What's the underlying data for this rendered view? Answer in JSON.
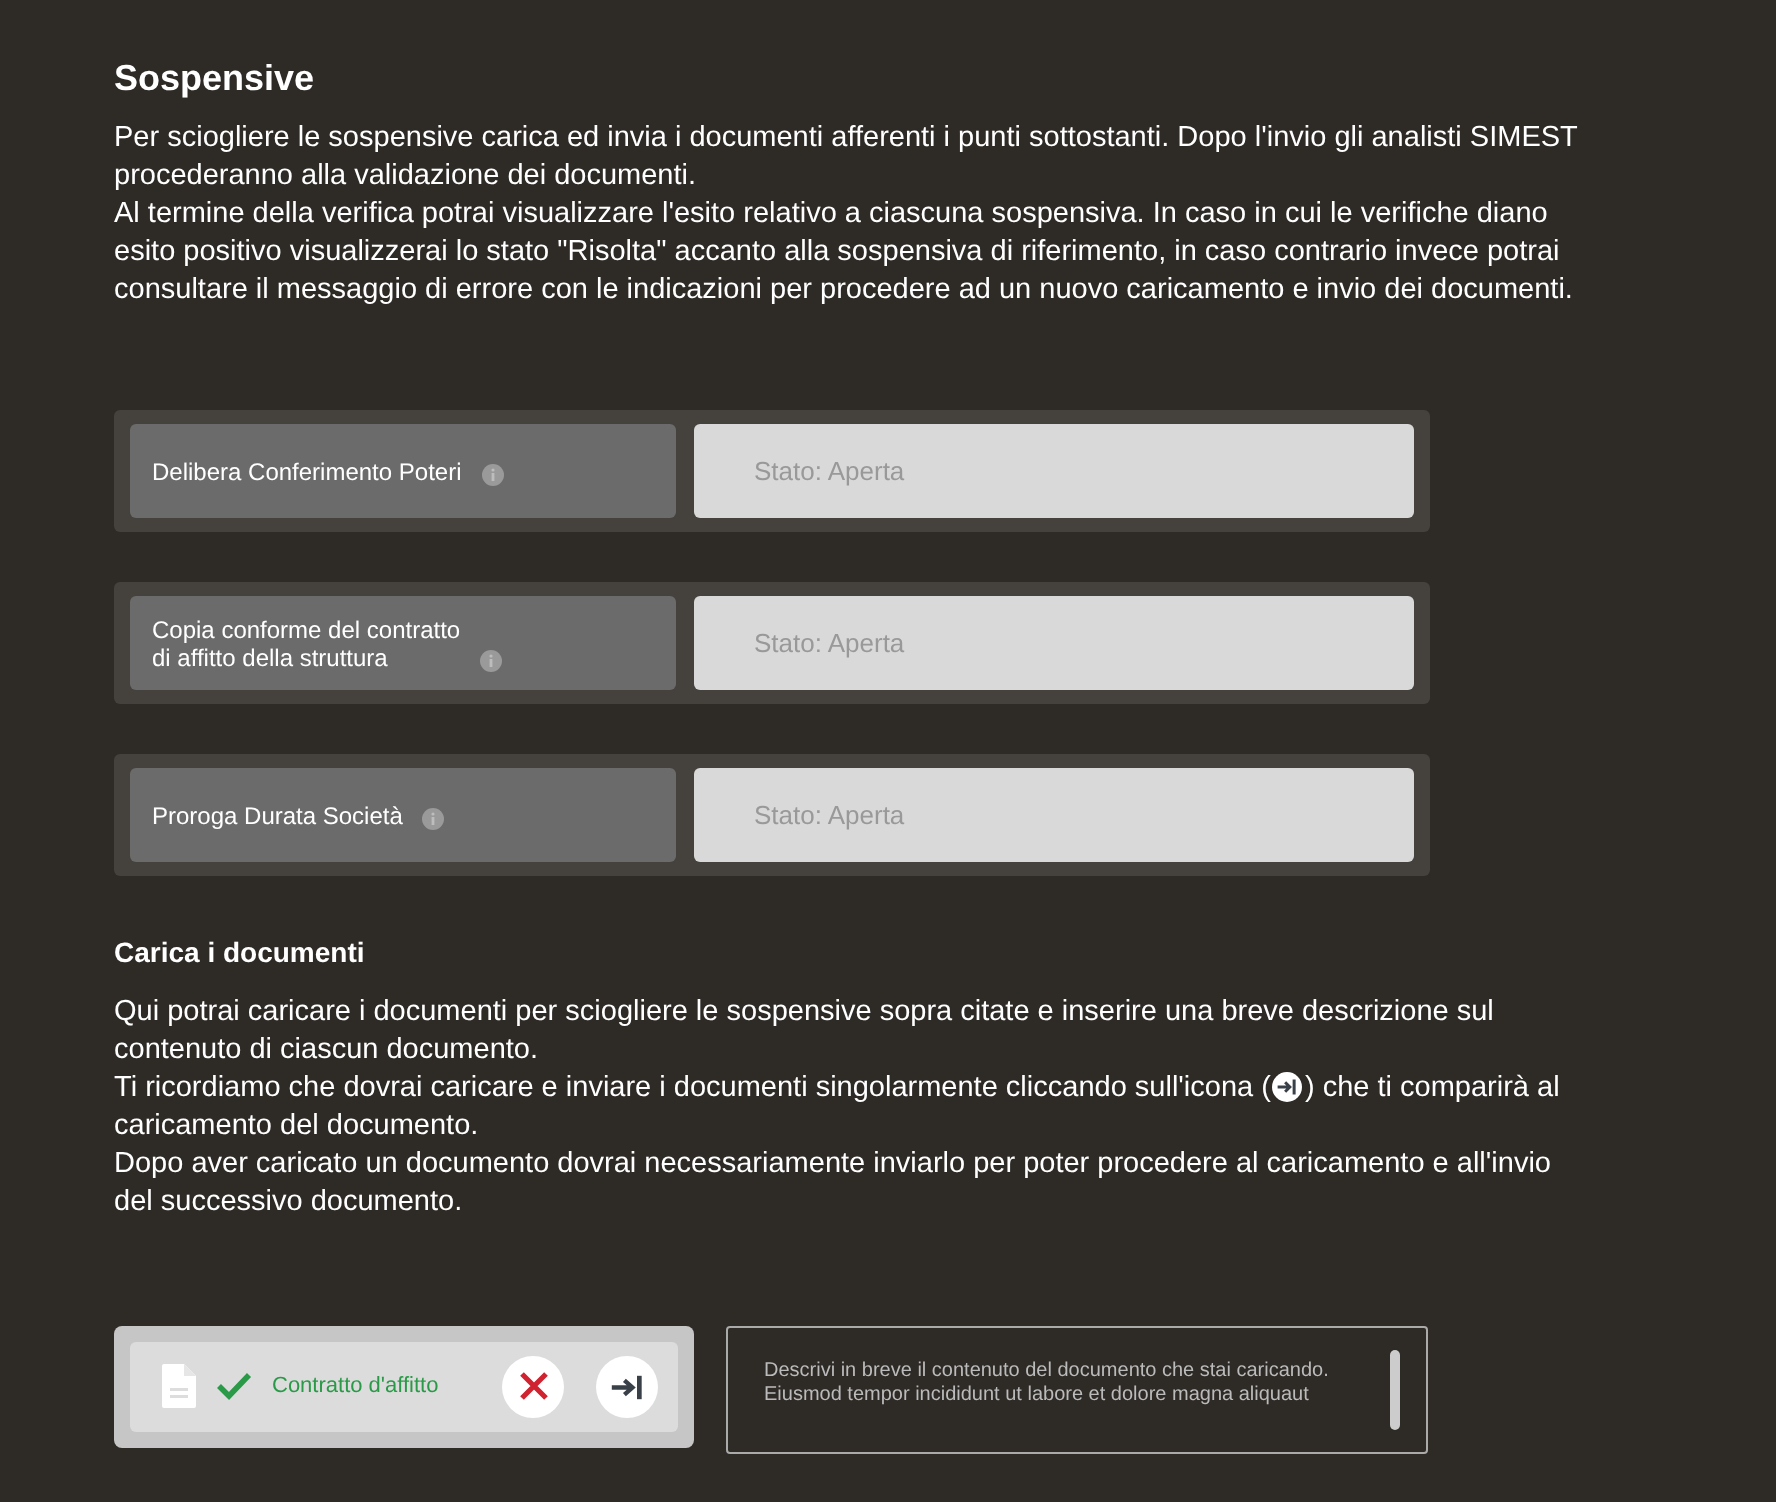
{
  "title": "Sospensive",
  "intro": [
    "Per sciogliere le sospensive carica ed invia i documenti afferenti i punti sottostanti. Dopo l'invio gli analisti SIMEST procederanno alla validazione dei documenti.",
    "Al termine della verifica potrai visualizzare l'esito relativo a ciascuna sospensiva. In caso in cui le verifiche diano esito positivo visualizzerai lo stato \"Risolta\" accanto alla sospensiva di riferimento, in caso contrario invece potrai consultare  il messaggio di errore con le indicazioni per procedere ad un nuovo caricamento e invio dei documenti."
  ],
  "sospensive": [
    {
      "label": [
        "Delibera Conferimento Poteri"
      ],
      "status": "Stato: Aperta"
    },
    {
      "label": [
        "Copia conforme del contratto",
        "di affitto della struttura"
      ],
      "status": "Stato: Aperta"
    },
    {
      "label": [
        "Proroga Durata Società"
      ],
      "status": "Stato: Aperta"
    }
  ],
  "upload_section": {
    "title": "Carica i documenti",
    "paragraphs": [
      {
        "text": "Qui potrai caricare i documenti per sciogliere le sospensive sopra citate e inserire una breve descrizione sul contenuto di ciascun documento."
      },
      {
        "text": "Ti ricordiamo che dovrai caricare e inviare i documenti singolarmente cliccando sull'icona (",
        "text_after": ") che ti comparirà al caricamento del documento."
      },
      {
        "text": "Dopo aver caricato un documento dovrai necessariamente inviarlo per poter procedere al caricamento e all'invio del successivo documento."
      }
    ]
  },
  "file": {
    "name": "Contratto d'affitto",
    "uploaded": true
  },
  "description": {
    "value": "Descrivi in breve il contenuto del documento che stai caricando. Eiusmod tempor incididunt ut labore et dolore magna aliquaut"
  }
}
